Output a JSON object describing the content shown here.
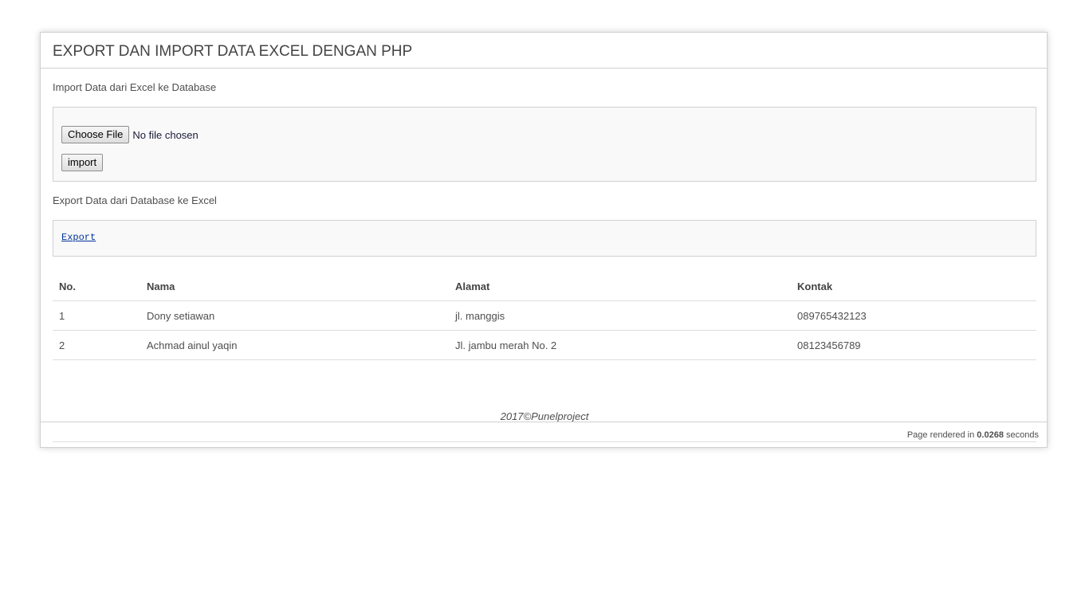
{
  "page": {
    "title": "EXPORT DAN IMPORT DATA EXCEL DENGAN PHP"
  },
  "import_section": {
    "label": "Import Data dari Excel ke Database",
    "choose_file_label": "Choose File",
    "file_status": "No file chosen",
    "import_button": "import"
  },
  "export_section": {
    "label": "Export Data dari Database ke Excel",
    "export_link": "Export"
  },
  "table": {
    "headers": [
      "No.",
      "Nama",
      "Alamat",
      "Kontak"
    ],
    "rows": [
      [
        "1",
        "Dony setiawan",
        "jl. manggis",
        "089765432123"
      ],
      [
        "2",
        "Achmad ainul yaqin",
        "Jl. jambu merah No. 2",
        "08123456789"
      ]
    ]
  },
  "footer": {
    "copyright": "2017©Punelproject",
    "render_prefix": "Page rendered in",
    "render_time": "0.0268",
    "render_suffix": "seconds"
  }
}
